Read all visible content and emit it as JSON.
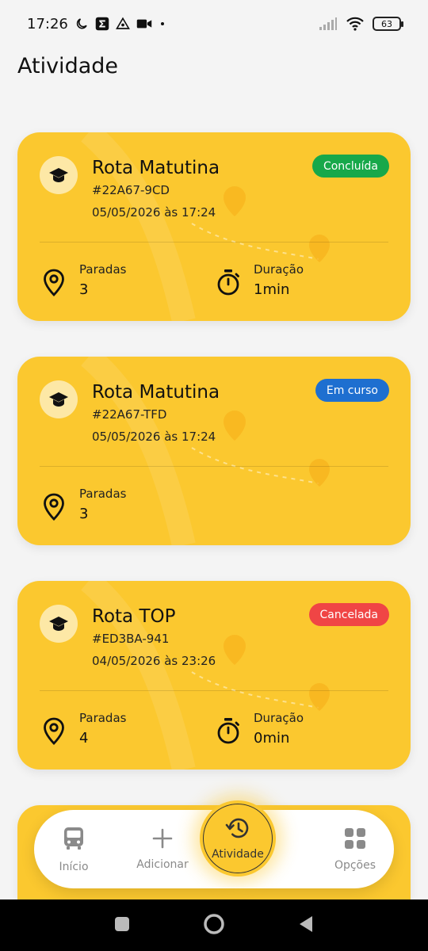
{
  "status_bar": {
    "time": "17:26",
    "battery": "63"
  },
  "page": {
    "title": "Atividade"
  },
  "cards": [
    {
      "name": "Rota Matutina",
      "code": "#22A67-9CD",
      "date": "05/05/2026 às 17:24",
      "status": "Concluída",
      "status_color": "#17a84a",
      "stops_label": "Paradas",
      "stops": "3",
      "duration_label": "Duração",
      "duration": "1min"
    },
    {
      "name": "Rota Matutina",
      "code": "#22A67-TFD",
      "date": "05/05/2026 às 17:24",
      "status": "Em curso",
      "status_color": "#1e6fd0",
      "stops_label": "Paradas",
      "stops": "3"
    },
    {
      "name": "Rota TOP",
      "code": "#ED3BA-941",
      "date": "04/05/2026 às 23:26",
      "status": "Cancelada",
      "status_color": "#f04545",
      "stops_label": "Paradas",
      "stops": "4",
      "duration_label": "Duração",
      "duration": "0min"
    }
  ],
  "bottom_nav": {
    "items": [
      {
        "label": "Início",
        "icon": "bus-icon"
      },
      {
        "label": "Adicionar",
        "icon": "plus-icon"
      },
      {
        "label": "Atividade",
        "icon": "history-icon",
        "active": true
      },
      {
        "label": "Opções",
        "icon": "grid-icon"
      }
    ]
  },
  "theme": {
    "accent": "#fbc82f",
    "background": "#f4f4f4"
  }
}
